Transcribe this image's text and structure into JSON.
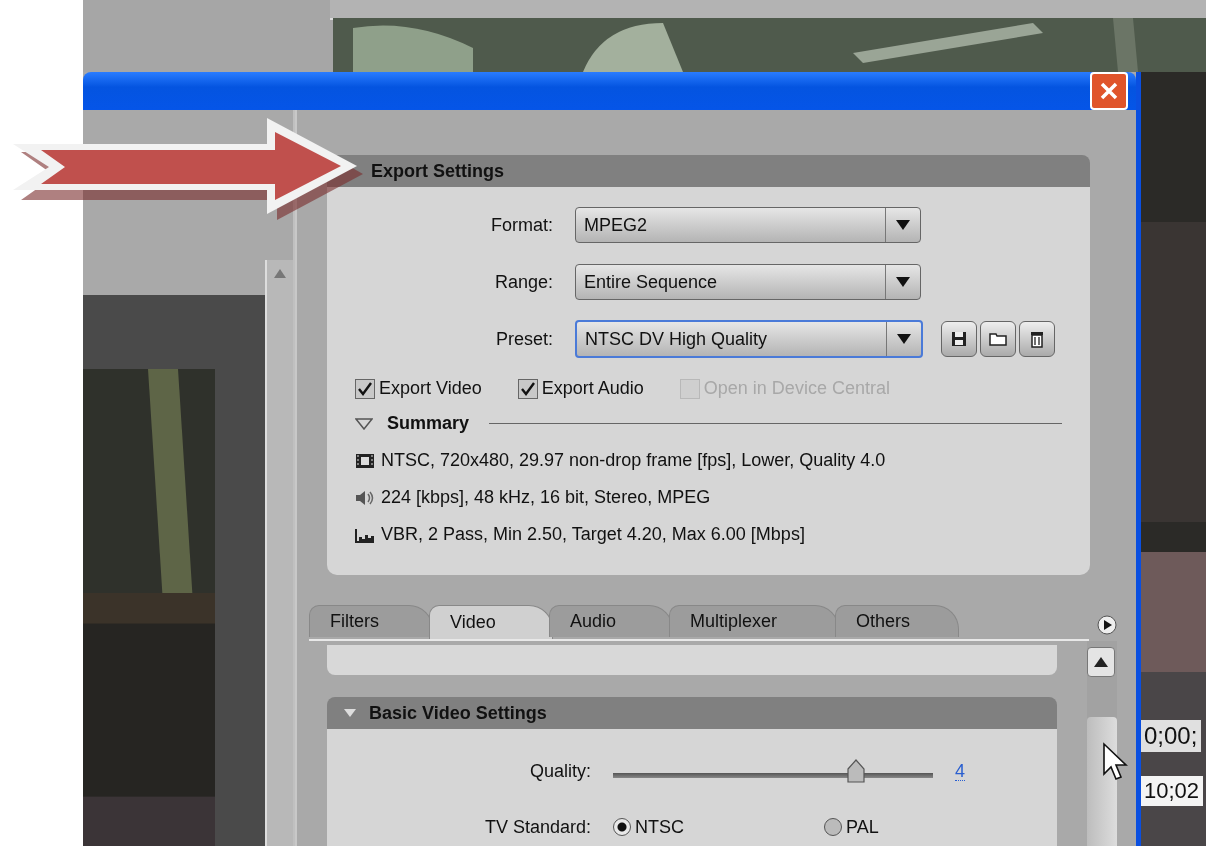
{
  "export_settings": {
    "title": "Export Settings",
    "fields": [
      {
        "label": "Format:",
        "value": "MPEG2",
        "focused": false
      },
      {
        "label": "Range:",
        "value": "Entire Sequence",
        "focused": false
      },
      {
        "label": "Preset:",
        "value": "NTSC DV High Quality",
        "focused": true
      }
    ],
    "checkboxes": [
      {
        "label": "Export Video",
        "checked": true,
        "disabled": false
      },
      {
        "label": "Export Audio",
        "checked": true,
        "disabled": false
      },
      {
        "label": "Open in Device Central",
        "checked": false,
        "disabled": true
      }
    ],
    "summary": {
      "title": "Summary",
      "expanded": true,
      "lines": [
        {
          "kind": "video",
          "text": "NTSC, 720x480, 29.97 non-drop frame [fps], Lower, Quality 4.0"
        },
        {
          "kind": "audio",
          "text": "224 [kbps], 48 kHz, 16 bit, Stereo, MPEG"
        },
        {
          "kind": "bitrate",
          "text": "VBR, 2 Pass, Min 2.50, Target 4.20, Max 6.00 [Mbps]"
        }
      ]
    }
  },
  "tabs": [
    {
      "label": "Filters",
      "selected": false
    },
    {
      "label": "Video",
      "selected": true
    },
    {
      "label": "Audio",
      "selected": false
    },
    {
      "label": "Multiplexer",
      "selected": false
    },
    {
      "label": "Others",
      "selected": false
    }
  ],
  "basic_video_settings": {
    "title": "Basic Video Settings",
    "expanded": true,
    "quality": {
      "label": "Quality:",
      "level": 0.76,
      "value": "4"
    },
    "tv_standard": {
      "label": "TV Standard:",
      "options": [
        {
          "label": "NTSC",
          "selected": true
        },
        {
          "label": "PAL",
          "selected": false
        }
      ]
    }
  },
  "timeline": {
    "timecodes": [
      "0;00;",
      "10;02"
    ]
  }
}
